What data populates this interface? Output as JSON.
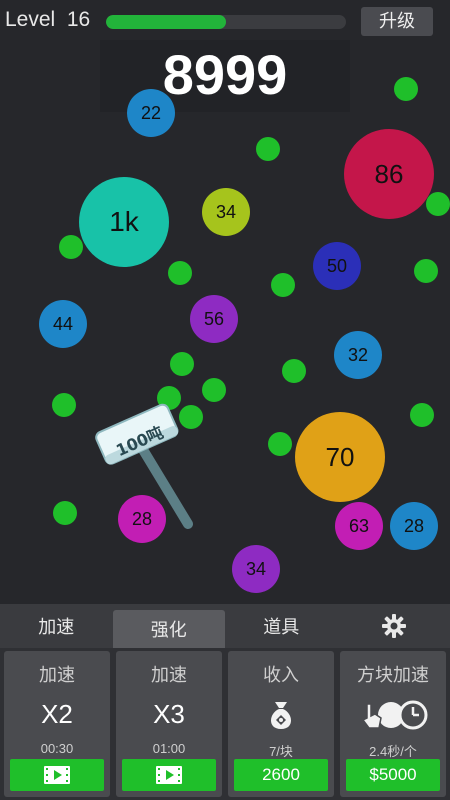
{
  "header": {
    "level_label": "Level",
    "level_value": "16",
    "progress": 0.5,
    "upgrade_label": "升级"
  },
  "score": "8999",
  "balls": [
    {
      "label": "22",
      "color": "#1e86c8"
    },
    {
      "label": "86",
      "color": "#c4164a"
    },
    {
      "label": "1k",
      "color": "#18c2a8"
    },
    {
      "label": "34",
      "color": "#a6c41c"
    },
    {
      "label": "50",
      "color": "#2b2fb8"
    },
    {
      "label": "44",
      "color": "#1e86c8"
    },
    {
      "label": "56",
      "color": "#8e2bc2"
    },
    {
      "label": "32",
      "color": "#1e86c8"
    },
    {
      "label": "70",
      "color": "#e0a117"
    },
    {
      "label": "63",
      "color": "#c21eb4"
    },
    {
      "label": "28",
      "color": "#1e86c8"
    },
    {
      "label": "28",
      "color": "#c21eb4"
    },
    {
      "label": "34",
      "color": "#8e2bc2"
    }
  ],
  "hammer_label": "100吨",
  "tabs": [
    {
      "label": "加速"
    },
    {
      "label": "强化"
    },
    {
      "label": "道具"
    },
    {
      "label": "settings"
    }
  ],
  "cards": [
    {
      "title": "加速",
      "big": "X2",
      "sub": "00:30",
      "icon": "video-play-icon"
    },
    {
      "title": "加速",
      "big": "X3",
      "sub": "01:00",
      "icon": "video-play-icon"
    },
    {
      "title": "收入",
      "sub": "7/块",
      "button": "2600",
      "icon": "money-bag-icon"
    },
    {
      "title": "方块加速",
      "sub": "2.4秒/个",
      "button": "$5000",
      "icon": "tap-clock-icon"
    }
  ],
  "colors": {
    "accent": "#1fbf2a",
    "background": "#26272b"
  }
}
